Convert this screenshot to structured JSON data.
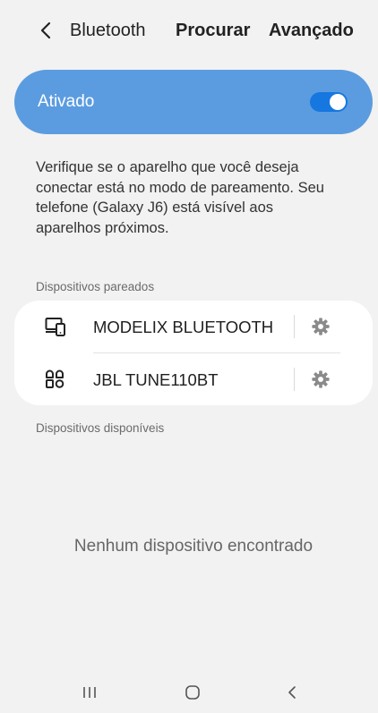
{
  "header": {
    "title": "Bluetooth",
    "actions": {
      "search_label": "Procurar",
      "advanced_label": "Avançado"
    }
  },
  "toggle": {
    "label": "Ativado",
    "state": "on",
    "accent_color": "#5b9ce0",
    "switch_color": "#1777e0"
  },
  "description": "Verifique se o aparelho que você deseja conectar está no modo de pareamento. Seu telefone (Galaxy J6) está visível aos aparelhos próximos.",
  "paired": {
    "section_title": "Dispositivos pareados",
    "devices": [
      {
        "name": "MODELIX BLUETOOTH",
        "icon": "devices-icon"
      },
      {
        "name": "JBL TUNE110BT",
        "icon": "headset-icon"
      }
    ]
  },
  "available": {
    "section_title": "Dispositivos disponíveis",
    "empty_text": "Nenhum dispositivo encontrado"
  },
  "navbar": {
    "recent": "recent-apps-icon",
    "home": "home-icon",
    "back": "back-icon"
  }
}
